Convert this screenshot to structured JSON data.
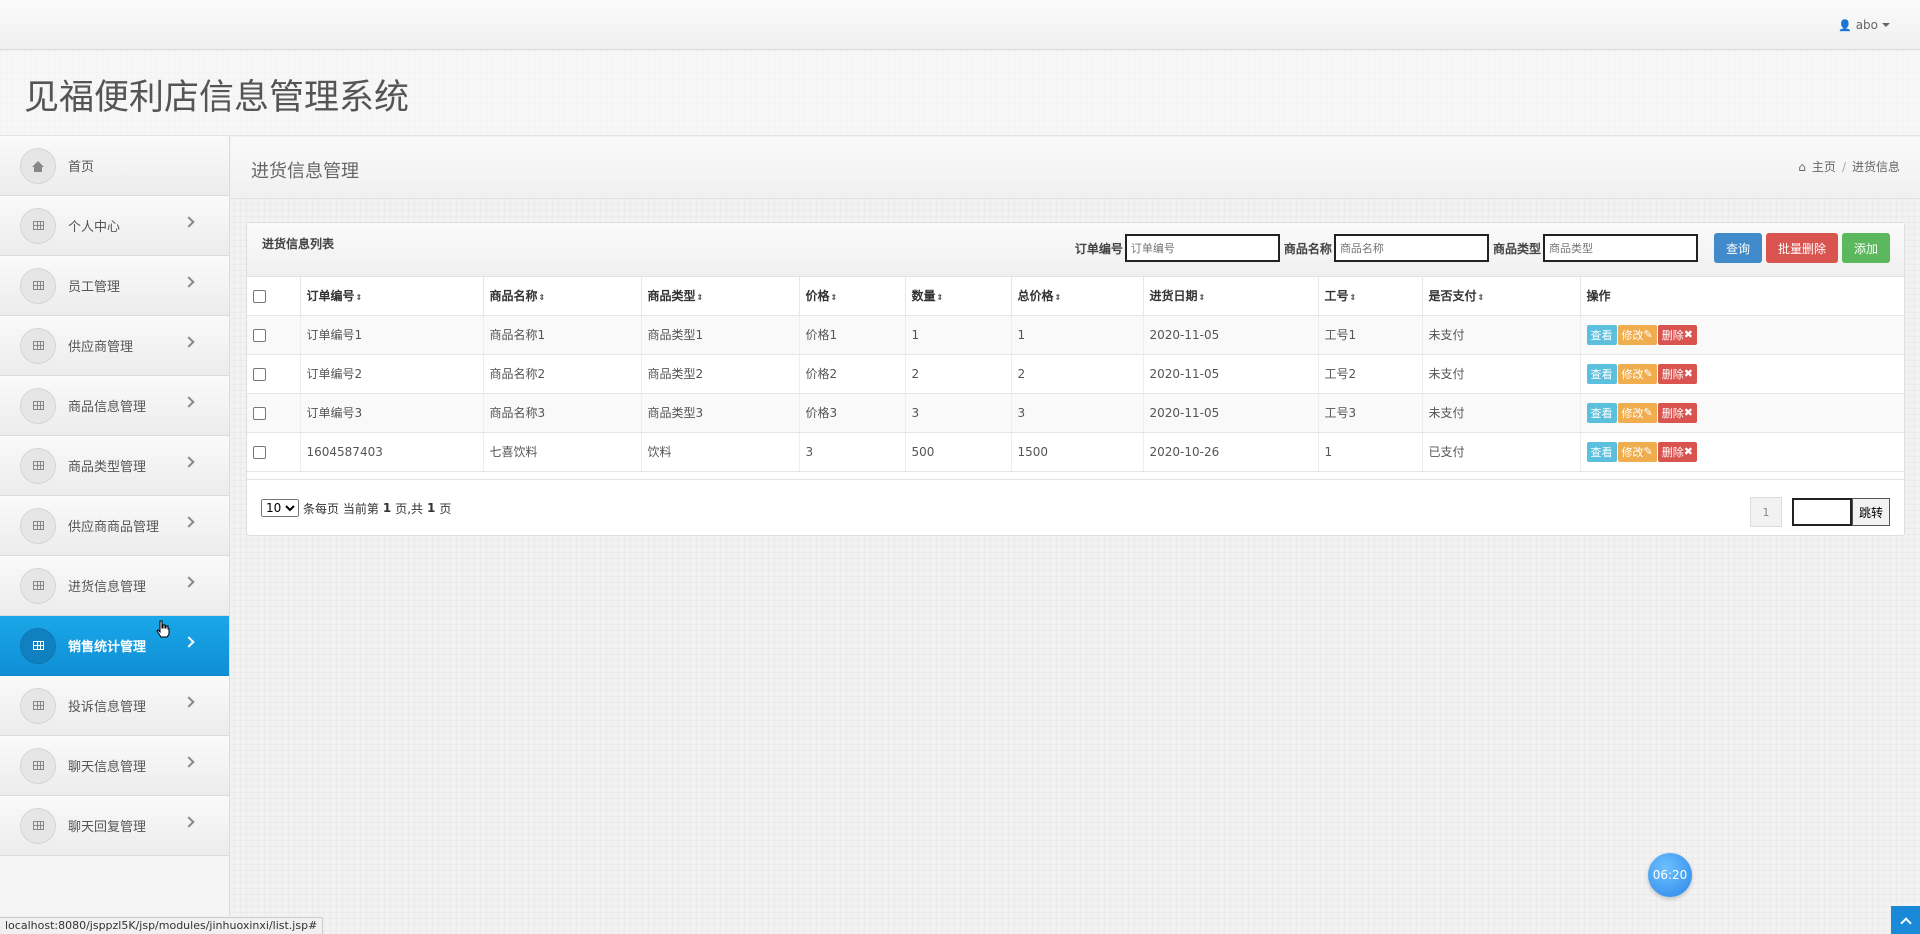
{
  "topbar": {
    "user": "abo"
  },
  "header": {
    "app_title": "见福便利店信息管理系统"
  },
  "sidebar": {
    "items": [
      {
        "label": "首页",
        "icon": "home-icon"
      },
      {
        "label": "个人中心",
        "icon": "grid-icon"
      },
      {
        "label": "员工管理",
        "icon": "grid-icon"
      },
      {
        "label": "供应商管理",
        "icon": "grid-icon"
      },
      {
        "label": "商品信息管理",
        "icon": "grid-icon"
      },
      {
        "label": "商品类型管理",
        "icon": "grid-icon"
      },
      {
        "label": "供应商商品管理",
        "icon": "grid-icon"
      },
      {
        "label": "进货信息管理",
        "icon": "grid-icon"
      },
      {
        "label": "销售统计管理",
        "icon": "grid-icon",
        "active": true
      },
      {
        "label": "投诉信息管理",
        "icon": "grid-icon"
      },
      {
        "label": "聊天信息管理",
        "icon": "grid-icon"
      },
      {
        "label": "聊天回复管理",
        "icon": "grid-icon"
      }
    ]
  },
  "page": {
    "title": "进货信息管理",
    "breadcrumb": {
      "home": "主页",
      "current": "进货信息"
    }
  },
  "panel": {
    "title": "进货信息列表",
    "filters": {
      "order_no_label": "订单编号",
      "order_no_placeholder": "订单编号",
      "product_name_label": "商品名称",
      "product_name_placeholder": "商品名称",
      "product_type_label": "商品类型",
      "product_type_placeholder": "商品类型"
    },
    "buttons": {
      "query": "查询",
      "batch_delete": "批量删除",
      "add": "添加"
    }
  },
  "table": {
    "columns": [
      "订单编号",
      "商品名称",
      "商品类型",
      "价格",
      "数量",
      "总价格",
      "进货日期",
      "工号",
      "是否支付",
      "操作"
    ],
    "sort_mark": "⇕",
    "rows": [
      [
        "订单编号1",
        "商品名称1",
        "商品类型1",
        "价格1",
        "1",
        "1",
        "2020-11-05",
        "工号1",
        "未支付"
      ],
      [
        "订单编号2",
        "商品名称2",
        "商品类型2",
        "价格2",
        "2",
        "2",
        "2020-11-05",
        "工号2",
        "未支付"
      ],
      [
        "订单编号3",
        "商品名称3",
        "商品类型3",
        "价格3",
        "3",
        "3",
        "2020-11-05",
        "工号3",
        "未支付"
      ],
      [
        "1604587403",
        "七喜饮料",
        "饮料",
        "3",
        "500",
        "1500",
        "2020-10-26",
        "1",
        "已支付"
      ]
    ],
    "actions": {
      "view": "查看",
      "edit": "修改",
      "edit_icon": "✎",
      "delete": "删除",
      "delete_icon": "✖"
    }
  },
  "pagination": {
    "page_size": "10",
    "page_size_options": [
      "10"
    ],
    "per_page_text": "条每页 当前第",
    "current": "1",
    "of_text": "页,共",
    "total": "1",
    "page_suffix": "页",
    "page_button": "1",
    "jump_label": "跳转"
  },
  "clock": "06:20",
  "statusbar": "localhost:8080/jsppzl5K/jsp/modules/jinhuoxinxi/list.jsp#"
}
